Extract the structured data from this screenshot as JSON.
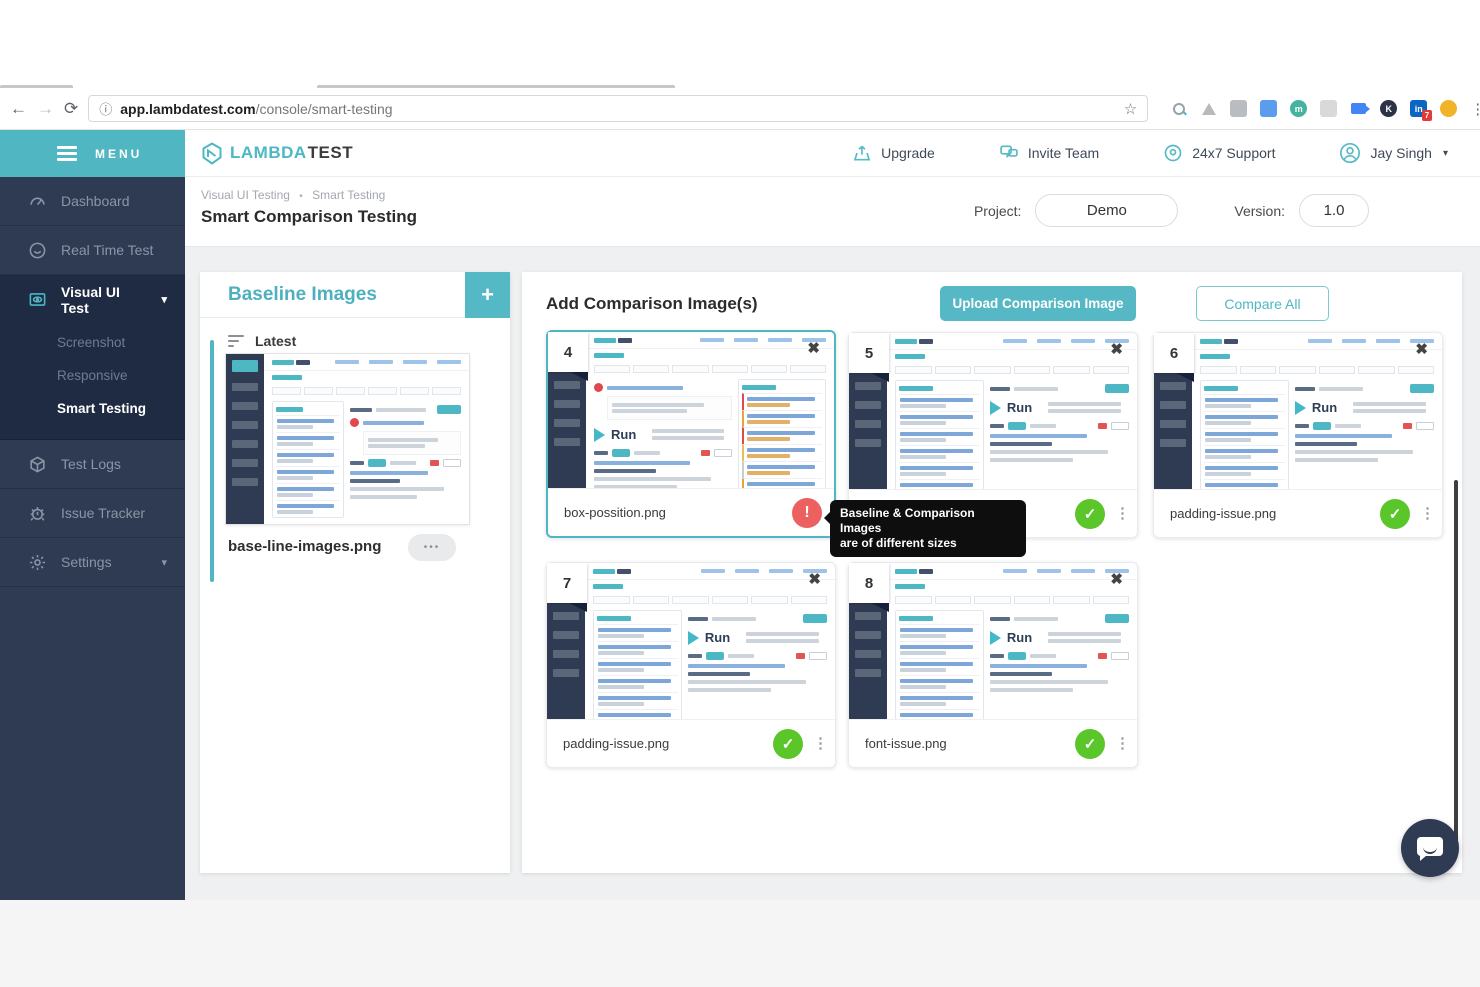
{
  "browser": {
    "url_domain": "app.lambdatest.com",
    "url_path": "/console/smart-testing",
    "ext_m": "m",
    "ext_k": "K",
    "ext_in": "in",
    "ext_badge": "7"
  },
  "icons": {
    "back": "←",
    "forward": "→",
    "reload": "⟳",
    "info": "ⓘ",
    "star": "☆",
    "browser_menu": "⋮",
    "close": "✖",
    "kebab": "⋮",
    "check": "✓",
    "error": "!",
    "plus": "+",
    "caret_down": "▾",
    "dot": "•",
    "ellipsis": "•••"
  },
  "sidebar": {
    "menu_label": "MENU",
    "dashboard": "Dashboard",
    "real_time": "Real Time Test",
    "visual_ui": "Visual UI Test",
    "screenshot": "Screenshot",
    "responsive": "Responsive",
    "smart_testing": "Smart Testing",
    "test_logs": "Test Logs",
    "issue_tracker": "Issue Tracker",
    "settings": "Settings"
  },
  "header": {
    "logo_primary": "LAMBDA",
    "logo_secondary": "TEST",
    "upgrade": "Upgrade",
    "invite": "Invite Team",
    "support": "24x7 Support",
    "user": "Jay Singh"
  },
  "page": {
    "breadcrumb_1": "Visual UI Testing",
    "breadcrumb_2": "Smart Testing",
    "title": "Smart Comparison Testing",
    "project_label": "Project:",
    "project_value": "Demo",
    "version_label": "Version:",
    "version_value": "1.0"
  },
  "baseline": {
    "title": "Baseline Images",
    "filter_label": "Latest",
    "filename": "base-line-images.png"
  },
  "comparison": {
    "heading": "Add Comparison Image(s)",
    "upload_label": "Upload Comparison Image",
    "compare_label": "Compare All",
    "run_label": "Run",
    "tooltip_line1": "Baseline & Comparison Images",
    "tooltip_line2": "are of different sizes",
    "cards": [
      {
        "number": "4",
        "filename": "box-possition.png",
        "status": "error"
      },
      {
        "number": "5",
        "filename": "",
        "status": "ok"
      },
      {
        "number": "6",
        "filename": "padding-issue.png",
        "status": "ok"
      },
      {
        "number": "7",
        "filename": "padding-issue.png",
        "status": "ok"
      },
      {
        "number": "8",
        "filename": "font-issue.png",
        "status": "ok"
      }
    ]
  },
  "colors": {
    "teal": "#4db7c4",
    "navy": "#2e3b52",
    "navy_dark": "#1f2b42",
    "green": "#5bc629",
    "red": "#ed6060"
  }
}
